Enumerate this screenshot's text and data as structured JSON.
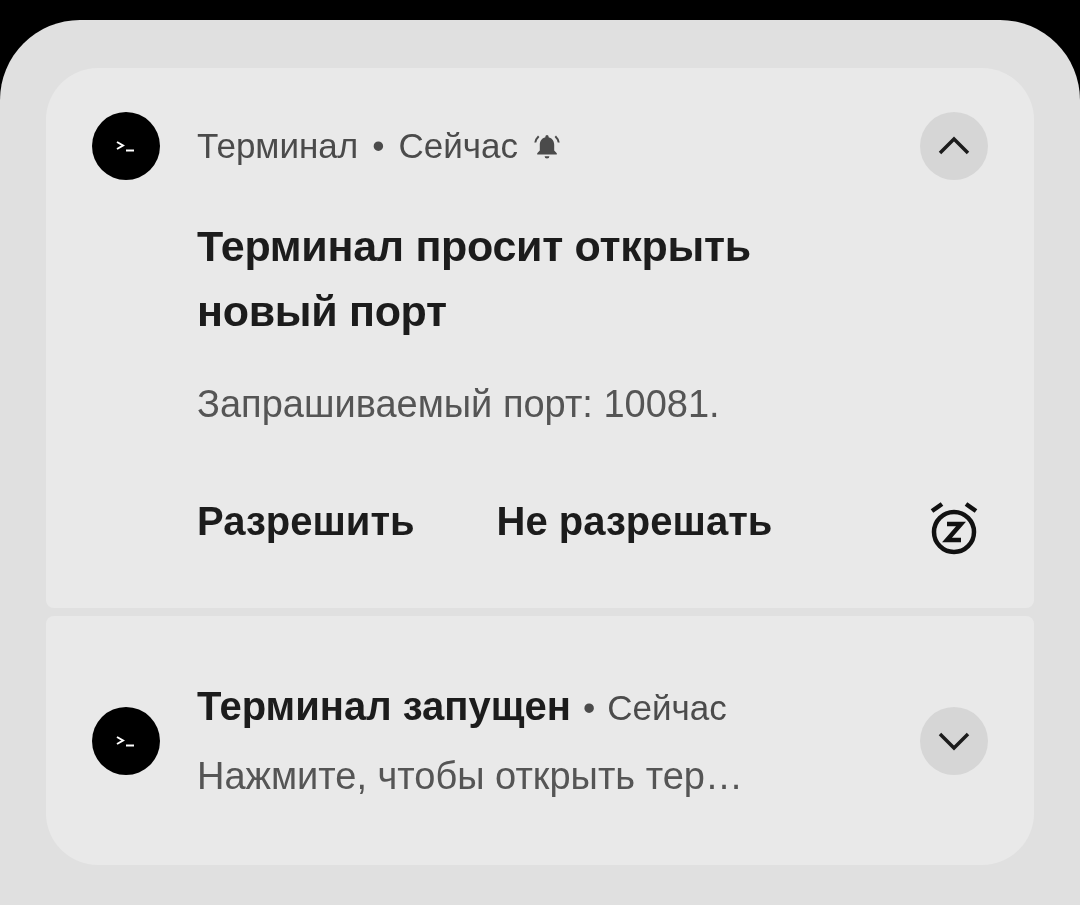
{
  "notifications": [
    {
      "app": "Терминал",
      "separator": "•",
      "time": "Сейчас",
      "alerting": true,
      "expanded": true,
      "title": "Терминал просит открыть новый порт",
      "text": "Запрашиваемый порт: 10081.",
      "actions": [
        "Разрешить",
        "Не разрешать"
      ],
      "snooze": true
    },
    {
      "title": "Терминал запущен",
      "separator": "•",
      "time": "Сейчас",
      "expanded": false,
      "text": "Нажмите, чтобы открыть тер…"
    }
  ]
}
